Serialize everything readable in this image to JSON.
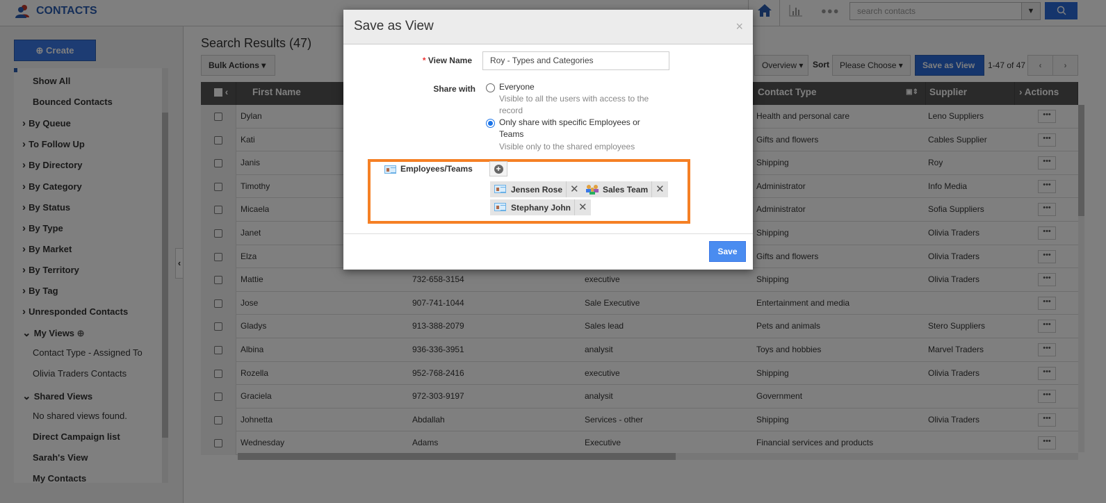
{
  "app": {
    "title": "CONTACTS",
    "search_placeholder": "search contacts"
  },
  "sidebar": {
    "create": "Create",
    "items": [
      {
        "label": "Show All",
        "type": "plain"
      },
      {
        "label": "Bounced Contacts",
        "type": "plain"
      },
      {
        "label": "By Queue",
        "type": "cat"
      },
      {
        "label": "To Follow Up",
        "type": "cat"
      },
      {
        "label": "By Directory",
        "type": "cat"
      },
      {
        "label": "By Category",
        "type": "cat"
      },
      {
        "label": "By Status",
        "type": "cat"
      },
      {
        "label": "By Type",
        "type": "cat"
      },
      {
        "label": "By Market",
        "type": "cat"
      },
      {
        "label": "By Territory",
        "type": "cat"
      },
      {
        "label": "By Tag",
        "type": "cat"
      },
      {
        "label": "Unresponded Contacts",
        "type": "cat"
      },
      {
        "label": "My Views",
        "type": "open"
      },
      {
        "label": "Contact Type - Assigned To",
        "type": "sub"
      },
      {
        "label": "Olivia Traders Contacts",
        "type": "sub"
      },
      {
        "label": "Shared Views",
        "type": "open"
      },
      {
        "label": "No shared views found.",
        "type": "sub"
      },
      {
        "label": "Direct Campaign list",
        "type": "plain"
      },
      {
        "label": "Sarah's View",
        "type": "plain"
      },
      {
        "label": "My Contacts",
        "type": "plain"
      }
    ]
  },
  "main": {
    "title": "Search Results (47)",
    "bulk_actions": "Bulk Actions",
    "overview": "Overview",
    "sort_label": "Sort",
    "sort_value": "Please Choose",
    "save_as_view": "Save as View",
    "pagination": "1-47 of 47",
    "columns": [
      "First Name",
      "",
      "",
      "Contact Type",
      "Supplier",
      "Actions"
    ],
    "rows": [
      [
        "Dylan",
        "",
        "",
        "Health and personal care",
        "Leno Suppliers"
      ],
      [
        "Kati",
        "",
        "",
        "Gifts and flowers",
        "Cables Supplier"
      ],
      [
        "Janis",
        "",
        "",
        "Shipping",
        "Roy"
      ],
      [
        "Timothy",
        "",
        "",
        "Administrator",
        "Info Media"
      ],
      [
        "Micaela",
        "",
        "",
        "Administrator",
        "Sofia Suppliers"
      ],
      [
        "Janet",
        "",
        "",
        "Shipping",
        "Olivia Traders"
      ],
      [
        "Elza",
        "",
        "",
        "Gifts and flowers",
        "Olivia Traders"
      ],
      [
        "Mattie",
        "732-658-3154",
        "executive",
        "Shipping",
        "Olivia Traders"
      ],
      [
        "Jose",
        "907-741-1044",
        "Sale Executive",
        "Entertainment and media",
        ""
      ],
      [
        "Gladys",
        "913-388-2079",
        "Sales lead",
        "Pets and animals",
        "Stero Suppliers"
      ],
      [
        "Albina",
        "936-336-3951",
        "analysit",
        "Toys and hobbies",
        "Marvel Traders"
      ],
      [
        "Rozella",
        "952-768-2416",
        "executive",
        "Shipping",
        "Olivia Traders"
      ],
      [
        "Graciela",
        "972-303-9197",
        "analysit",
        "Government",
        ""
      ],
      [
        "Johnetta",
        "Abdallah",
        "Services - other",
        "Shipping",
        "Olivia Traders"
      ],
      [
        "Wednesday",
        "Adams",
        "Executive",
        "Financial services and products",
        ""
      ]
    ]
  },
  "modal": {
    "title": "Save as View",
    "view_name_label": "View Name",
    "view_name_value": "Roy - Types and Categories",
    "share_label": "Share with",
    "options": [
      {
        "label": "Everyone",
        "desc": "Visible to all the users with access to the record",
        "selected": false
      },
      {
        "label": "Only share with specific Employees or Teams",
        "desc": "Visible only to the shared employees",
        "selected": true
      }
    ],
    "employees_label": "Employees/Teams",
    "chips": [
      {
        "label": "Jensen Rose",
        "icon": "employee-card-icon"
      },
      {
        "label": "Sales Team",
        "icon": "team-icon"
      },
      {
        "label": "Stephany John",
        "icon": "employee-card-icon"
      }
    ],
    "save": "Save",
    "highlight_color": "#f58025"
  }
}
